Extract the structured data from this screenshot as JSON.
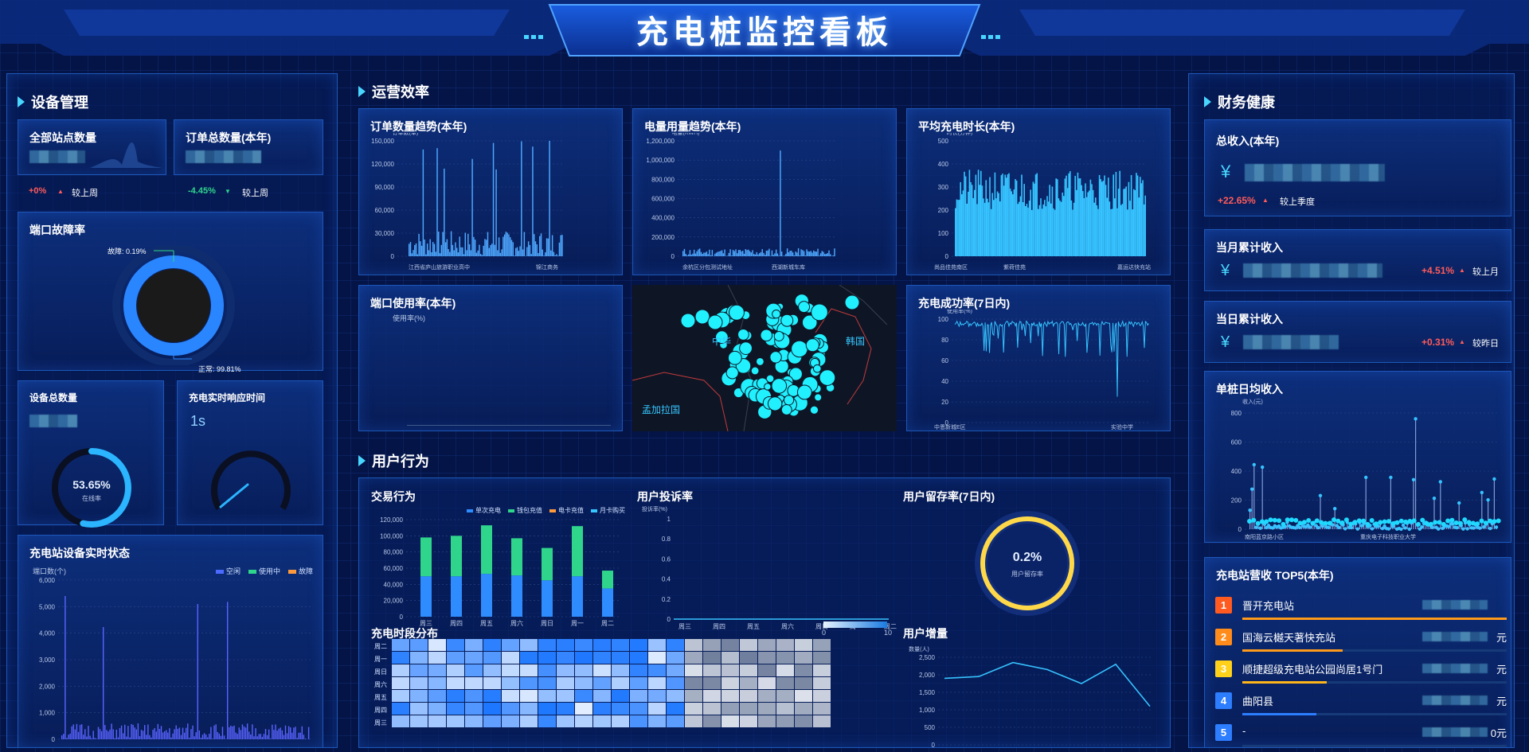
{
  "header": {
    "title": "充电桩监控看板"
  },
  "sections": {
    "device": "设备管理",
    "ops": "运营效率",
    "user": "用户行为",
    "finance": "财务健康"
  },
  "device": {
    "stations": {
      "title": "全部站点数量",
      "delta": "+0%",
      "compare": "较上周"
    },
    "orders": {
      "title": "订单总数量(本年)",
      "delta": "-4.45%",
      "compare": "较上周"
    },
    "fault": {
      "title": "端口故障率",
      "fault_label": "故障: 0.19%",
      "normal_label": "正常: 99.81%",
      "fault_pct": 0.19
    },
    "total": {
      "title": "设备总数量",
      "pct": "53.65%",
      "pct_label": "在线率",
      "online_rate": 53.65
    },
    "response": {
      "title": "充电实时响应时间",
      "value": "1s"
    },
    "status": {
      "title": "充电站设备实时状态",
      "ylabel": "端口数(个)",
      "legend": [
        "空闲",
        "使用中",
        "故障"
      ],
      "yticks": [
        "6,000",
        "5,000",
        "4,000",
        "3,000",
        "2,000",
        "1,000",
        "0"
      ]
    }
  },
  "ops": {
    "orders_trend": {
      "title": "订单数量趋势(本年)",
      "ylabel": "订单数(单)",
      "yticks": [
        "150,000",
        "120,000",
        "90,000",
        "60,000",
        "30,000",
        "0"
      ],
      "xticks": [
        "江西省庐山旅游职业高中",
        "锦江商务"
      ]
    },
    "power_trend": {
      "title": "电量用量趋势(本年)",
      "ylabel": "电量(KWH)",
      "yticks": [
        "1,200,000",
        "1,000,000",
        "800,000",
        "600,000",
        "400,000",
        "200,000",
        "0"
      ],
      "xticks": [
        "余杭区分包测试地址",
        "西湖新城车库"
      ]
    },
    "avg_time": {
      "title": "平均充电时长(本年)",
      "ylabel": "时长(分钟)",
      "yticks": [
        "500",
        "400",
        "300",
        "200",
        "100",
        "0"
      ],
      "xticks": [
        "尚品佳苑南区",
        "紫荷佳苑",
        "嘉运达快充站"
      ]
    },
    "port_usage": {
      "title": "端口使用率(本年)",
      "ylabel": "使用率(%)"
    },
    "map": {
      "labels": [
        "中华",
        "韩国",
        "孟加拉国"
      ]
    },
    "success": {
      "title": "充电成功率(7日内)",
      "ylabel": "使用率(%)",
      "yticks": [
        "100",
        "80",
        "60",
        "40",
        "20",
        "0"
      ],
      "xticks": [
        "中恩新城E区",
        "实验中学"
      ]
    }
  },
  "user": {
    "trade": {
      "title": "交易行为",
      "legend": [
        "单次充电",
        "钱包充值",
        "电卡充值",
        "月卡购买"
      ],
      "yticks": [
        "120,000",
        "100,000",
        "80,000",
        "60,000",
        "40,000",
        "20,000",
        "0"
      ],
      "days": [
        "周三",
        "周四",
        "周五",
        "周六",
        "周日",
        "周一",
        "周二"
      ]
    },
    "complaint": {
      "title": "用户投诉率",
      "ylabel": "投诉率(%)",
      "yticks": [
        "1",
        "0.8",
        "0.6",
        "0.4",
        "0.2",
        "0"
      ],
      "days": [
        "周三",
        "周四",
        "周五",
        "周六",
        "周日",
        "周一",
        "周二"
      ]
    },
    "retention": {
      "title": "用户留存率(7日内)",
      "value": "0.2%",
      "label": "用户留存率"
    },
    "heatmap": {
      "title": "充电时段分布",
      "range_min": "0",
      "range_max": "10",
      "rows": [
        "周二",
        "周一",
        "周日",
        "周六",
        "周五",
        "周四",
        "周三"
      ]
    },
    "growth": {
      "title": "用户增量",
      "ylabel": "数量(人)",
      "yticks": [
        "2,500",
        "2,000",
        "1,500",
        "1,000",
        "500",
        "0"
      ]
    }
  },
  "finance": {
    "total": {
      "title": "总收入(本年)",
      "currency": "¥",
      "delta": "+22.65%",
      "compare": "较上季度"
    },
    "month": {
      "title": "当月累计收入",
      "currency": "¥",
      "delta": "+4.51%",
      "compare": "较上月"
    },
    "day": {
      "title": "当日累计收入",
      "currency": "¥",
      "delta": "+0.31%",
      "compare": "较昨日"
    },
    "per_pile": {
      "title": "单桩日均收入",
      "ylabel": "收入(元)",
      "yticks": [
        "800",
        "600",
        "400",
        "200",
        "0"
      ],
      "xticks": [
        "南阳蓝京路小区",
        "重庆电子科技职业大学"
      ]
    },
    "top5": {
      "title": "充电站营收 TOP5(本年)",
      "items": [
        {
          "rank": "1",
          "name": "晋开充电站",
          "value": "",
          "color": "#ff5a1f",
          "fill": 1.0
        },
        {
          "rank": "2",
          "name": "国海云樾天著快充站",
          "value": "元",
          "color": "#ff8c1a",
          "fill": 0.38
        },
        {
          "rank": "3",
          "name": "顺捷超级充电站公园尚居1号门",
          "value": "元",
          "color": "#ffd11a",
          "fill": 0.32
        },
        {
          "rank": "4",
          "name": "曲阳县",
          "value": "元",
          "color": "#2d7dff",
          "fill": 0.28
        },
        {
          "rank": "5",
          "name": "-",
          "value": "0元",
          "color": "#2d7dff",
          "fill": 0.0
        }
      ]
    }
  },
  "colors": {
    "accent": "#48d6ff",
    "bar": "#4ea8ff",
    "up": "#ff5b5b",
    "down": "#2fd58b"
  }
}
